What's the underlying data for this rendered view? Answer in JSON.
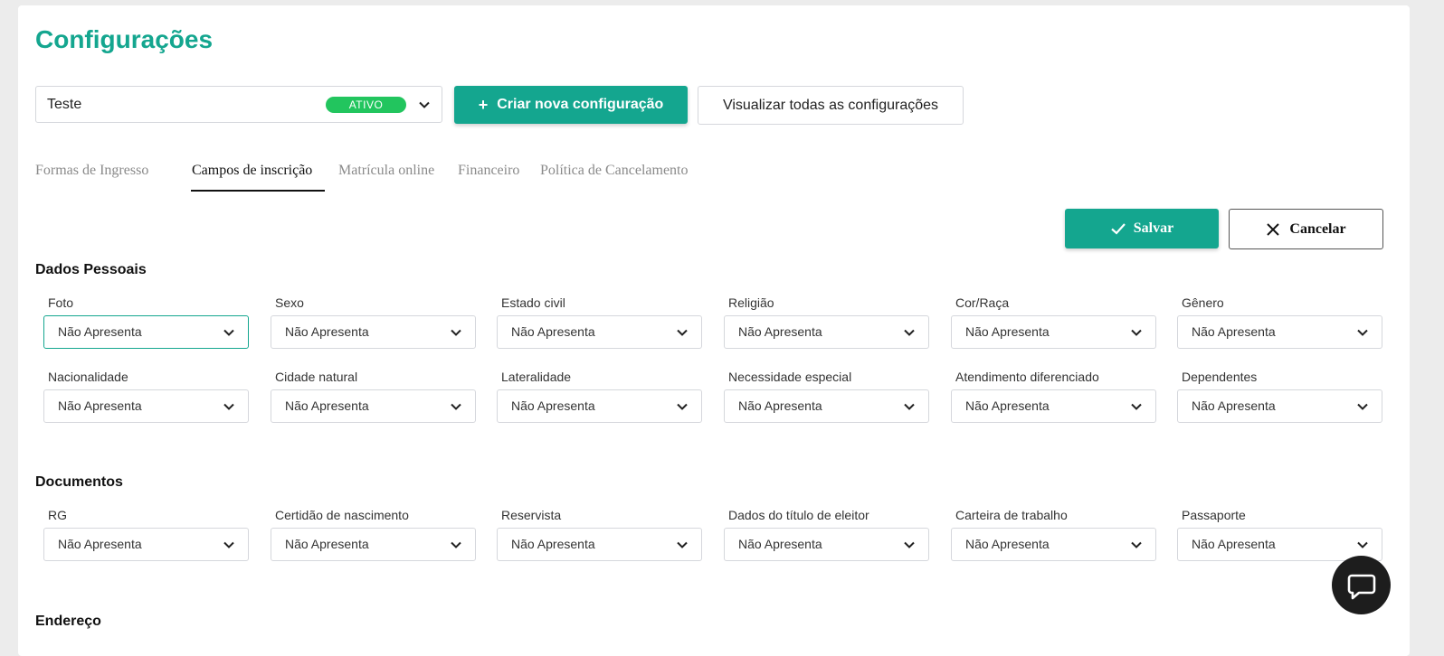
{
  "page": {
    "title": "Configurações"
  },
  "config_select": {
    "value": "Teste",
    "status_badge": "ATIVO"
  },
  "buttons": {
    "create_plus": "+",
    "create": "Criar nova configuração",
    "view_all": "Visualizar todas as configurações",
    "save": "Salvar",
    "cancel": "Cancelar"
  },
  "tabs": [
    {
      "label": "Formas de Ingresso",
      "active": false
    },
    {
      "label": "Campos de inscrição",
      "active": true
    },
    {
      "label": "Matrícula online",
      "active": false
    },
    {
      "label": "Financeiro",
      "active": false
    },
    {
      "label": "Política de Cancelamento",
      "active": false
    }
  ],
  "sections": [
    {
      "title": "Dados Pessoais",
      "fields": [
        {
          "label": "Foto",
          "value": "Não Apresenta"
        },
        {
          "label": "Sexo",
          "value": "Não Apresenta"
        },
        {
          "label": "Estado civil",
          "value": "Não Apresenta"
        },
        {
          "label": "Religião",
          "value": "Não Apresenta"
        },
        {
          "label": "Cor/Raça",
          "value": "Não Apresenta"
        },
        {
          "label": "Gênero",
          "value": "Não Apresenta"
        },
        {
          "label": "Nacionalidade",
          "value": "Não Apresenta"
        },
        {
          "label": "Cidade natural",
          "value": "Não Apresenta"
        },
        {
          "label": "Lateralidade",
          "value": "Não Apresenta"
        },
        {
          "label": "Necessidade especial",
          "value": "Não Apresenta"
        },
        {
          "label": "Atendimento diferenciado",
          "value": "Não Apresenta"
        },
        {
          "label": "Dependentes",
          "value": "Não Apresenta"
        }
      ]
    },
    {
      "title": "Documentos",
      "fields": [
        {
          "label": "RG",
          "value": "Não Apresenta"
        },
        {
          "label": "Certidão de nascimento",
          "value": "Não Apresenta"
        },
        {
          "label": "Reservista",
          "value": "Não Apresenta"
        },
        {
          "label": "Dados do título de eleitor",
          "value": "Não Apresenta"
        },
        {
          "label": "Carteira de trabalho",
          "value": "Não Apresenta"
        },
        {
          "label": "Passaporte",
          "value": "Não Apresenta"
        }
      ]
    },
    {
      "title": "Endereço",
      "fields": []
    }
  ],
  "colors": {
    "accent": "#14a68f",
    "badge": "#22c55e",
    "chat": "#1d1d1d"
  },
  "icons": {
    "select_arrow": "chevron-down-icon",
    "save": "check-icon",
    "cancel": "close-icon",
    "chat": "chat-bubble-icon"
  }
}
